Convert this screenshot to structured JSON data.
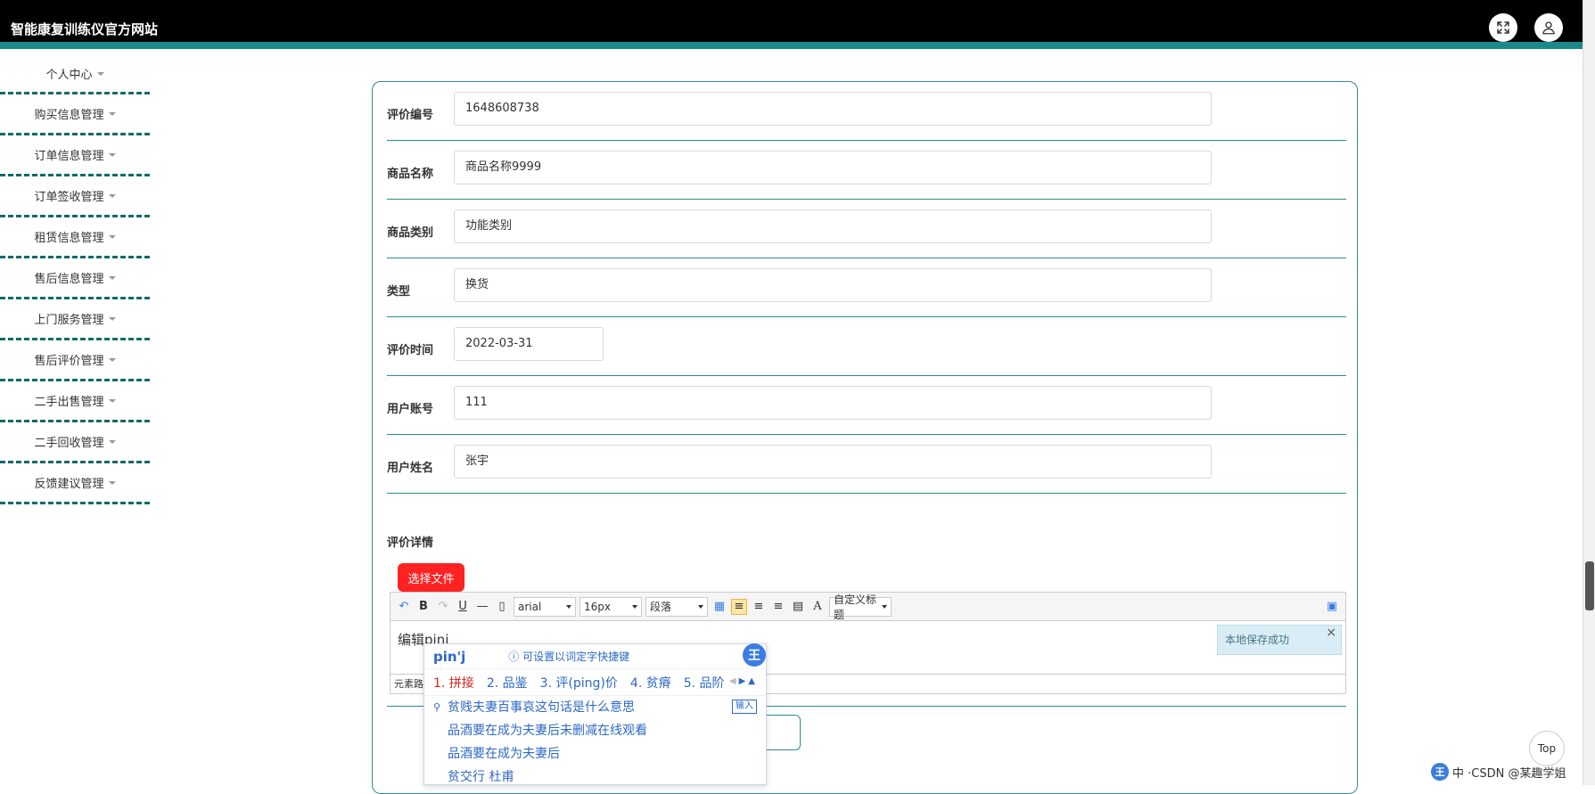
{
  "header": {
    "site_title": "智能康复训练仪官方网站"
  },
  "sidebar": {
    "items": [
      {
        "label": "个人中心"
      },
      {
        "label": "购买信息管理"
      },
      {
        "label": "订单信息管理"
      },
      {
        "label": "订单签收管理"
      },
      {
        "label": "租赁信息管理"
      },
      {
        "label": "售后信息管理"
      },
      {
        "label": "上门服务管理"
      },
      {
        "label": "售后评价管理"
      },
      {
        "label": "二手出售管理"
      },
      {
        "label": "二手回收管理"
      },
      {
        "label": "反馈建议管理"
      }
    ]
  },
  "form": {
    "fields": [
      {
        "label": "评价编号",
        "value": "1648608738"
      },
      {
        "label": "商品名称",
        "value": "商品名称9999"
      },
      {
        "label": "商品类别",
        "value": "功能类别"
      },
      {
        "label": "类型",
        "value": "换货"
      },
      {
        "label": "评价时间",
        "value": "2022-03-31"
      },
      {
        "label": "用户账号",
        "value": "111"
      },
      {
        "label": "用户姓名",
        "value": "张宇"
      }
    ],
    "detail_label": "评价详情",
    "choose_file_label": "选择文件"
  },
  "editor": {
    "font_family": "arial",
    "font_size": "16px",
    "paragraph": "段落",
    "custom_title": "自定义标题",
    "content_text": "编辑",
    "content_composing": "pini",
    "footer_text": "元素路",
    "save_toast": "本地保存成功"
  },
  "ime": {
    "composition": "pin'j",
    "tip": "可设置以词定字快捷键",
    "candidates": [
      "1. 拼接",
      "2. 品鉴",
      "3. 评(ping)价",
      "4. 贫瘠",
      "5. 品阶"
    ],
    "suggestions": [
      "贫贱夫妻百事哀这句话是什么意思",
      "品酒要在成为夫妻后未删减在线观看",
      "品酒要在成为夫妻后",
      "贫交行 杜甫"
    ],
    "input_tag": "输入",
    "badge": "王"
  },
  "top_button_label": "Top",
  "watermark": {
    "badge": "王",
    "text": "中 ·CSDN @某趣学姐"
  }
}
